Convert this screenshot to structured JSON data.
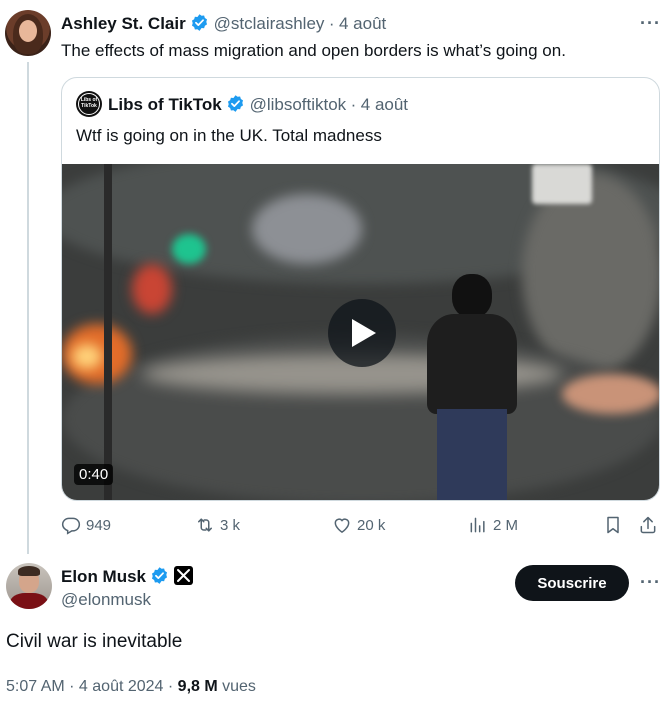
{
  "parent_tweet": {
    "author_name": "Ashley St. Clair",
    "handle": "@stclairashley",
    "separator": "·",
    "date": "4 août",
    "text": "The effects of mass migration and open borders is what’s going on."
  },
  "quoted_tweet": {
    "author_name": "Libs of TikTok",
    "avatar_text": "Libs of TikTok",
    "handle": "@libsoftiktok",
    "separator": "·",
    "date": "4 août",
    "text": "Wtf is going on in the UK. Total madness",
    "video_duration": "0:40"
  },
  "actions": {
    "replies": "949",
    "reposts": "3 k",
    "likes": "20 k",
    "views": "2 M"
  },
  "main_tweet": {
    "author_name": "Elon Musk",
    "handle": "@elonmusk",
    "subscribe_label": "Souscrire",
    "text": "Civil war is inevitable",
    "time": "5:07 AM · 4 août 2024 · ",
    "views_count": "9,8 M",
    "views_label": " vues"
  },
  "more_label": "···",
  "colors": {
    "verified_blue": "#1d9bf0",
    "muted": "#536471",
    "text": "#0f1419",
    "border": "#cfd9de"
  }
}
